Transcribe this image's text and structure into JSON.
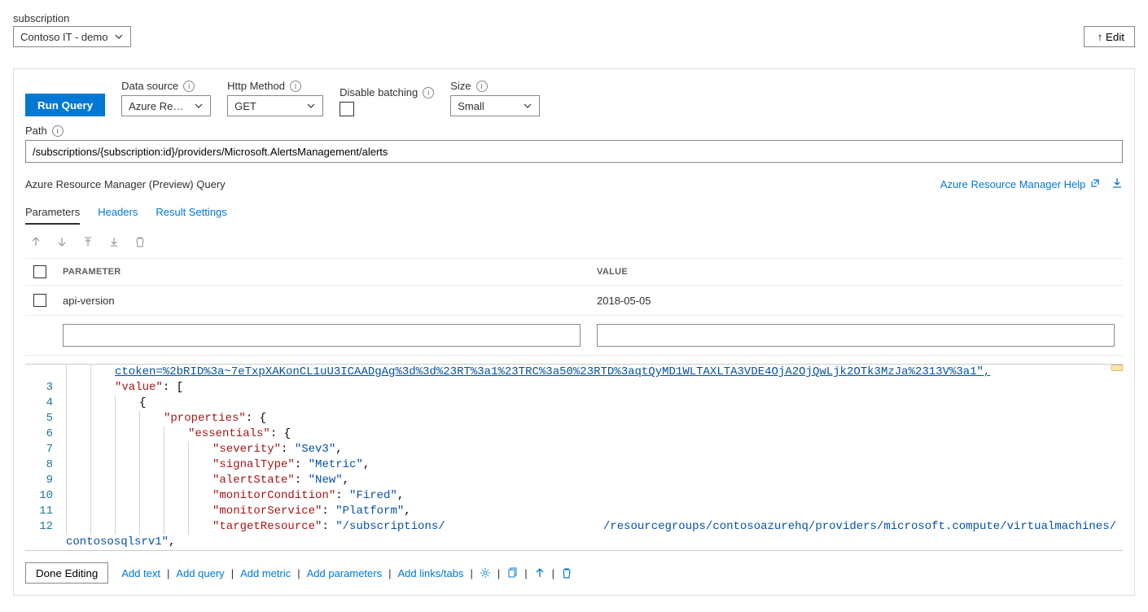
{
  "top": {
    "subscription_label": "subscription",
    "subscription_value": "Contoso IT - demo",
    "edit_label": "↑ Edit"
  },
  "query": {
    "run_label": "Run Query",
    "data_source_label": "Data source",
    "data_source_value": "Azure Reso…",
    "http_method_label": "Http Method",
    "http_method_value": "GET",
    "disable_batching_label": "Disable batching",
    "size_label": "Size",
    "size_value": "Small",
    "path_label": "Path",
    "path_value": "/subscriptions/{subscription:id}/providers/Microsoft.AlertsManagement/alerts"
  },
  "section": {
    "title": "Azure Resource Manager (Preview) Query",
    "help_link": "Azure Resource Manager Help"
  },
  "tabs": {
    "parameters": "Parameters",
    "headers": "Headers",
    "result_settings": "Result Settings"
  },
  "table": {
    "col_parameter": "PARAMETER",
    "col_value": "VALUE",
    "rows": [
      {
        "parameter": "api-version",
        "value": "2018-05-05"
      }
    ]
  },
  "code": {
    "lines": [
      {
        "n": "",
        "indent": 2,
        "raw_top": "ctoken=%2bRID%3a~7eTxpXAKonCL1uU3ICAADgAg%3d%3d%23RT%3a1%23TRC%3a50%23RTD%3aqtQyMD1WLTAXLTA3VDE4OjA2OjQwLjk2OTk3MzJa%2313V%3a1\","
      },
      {
        "n": "3",
        "indent": 2,
        "key": "\"value\"",
        "after": ": ["
      },
      {
        "n": "4",
        "indent": 3,
        "plain": "{"
      },
      {
        "n": "5",
        "indent": 4,
        "key": "\"properties\"",
        "after": ": {"
      },
      {
        "n": "6",
        "indent": 5,
        "key": "\"essentials\"",
        "after": ": {"
      },
      {
        "n": "7",
        "indent": 6,
        "key": "\"severity\"",
        "val": "\"Sev3\"",
        "comma": ","
      },
      {
        "n": "8",
        "indent": 6,
        "key": "\"signalType\"",
        "val": "\"Metric\"",
        "comma": ","
      },
      {
        "n": "9",
        "indent": 6,
        "key": "\"alertState\"",
        "val": "\"New\"",
        "comma": ","
      },
      {
        "n": "10",
        "indent": 6,
        "key": "\"monitorCondition\"",
        "val": "\"Fired\"",
        "comma": ","
      },
      {
        "n": "11",
        "indent": 6,
        "key": "\"monitorService\"",
        "val": "\"Platform\"",
        "comma": ","
      }
    ],
    "line12_num": "12",
    "line12_key": "\"targetResource\"",
    "line12_val_a": "\"/subscriptions/",
    "line12_val_b": "/resourcegroups/contosoazurehq/providers/microsoft.compute/virtualmachines/",
    "line12_wrap": "contososqlsrv1\"",
    "line12_comma": ","
  },
  "bottom": {
    "done_editing": "Done Editing",
    "add_text": "Add text",
    "add_query": "Add query",
    "add_metric": "Add metric",
    "add_parameters": "Add parameters",
    "add_links": "Add links/tabs"
  }
}
